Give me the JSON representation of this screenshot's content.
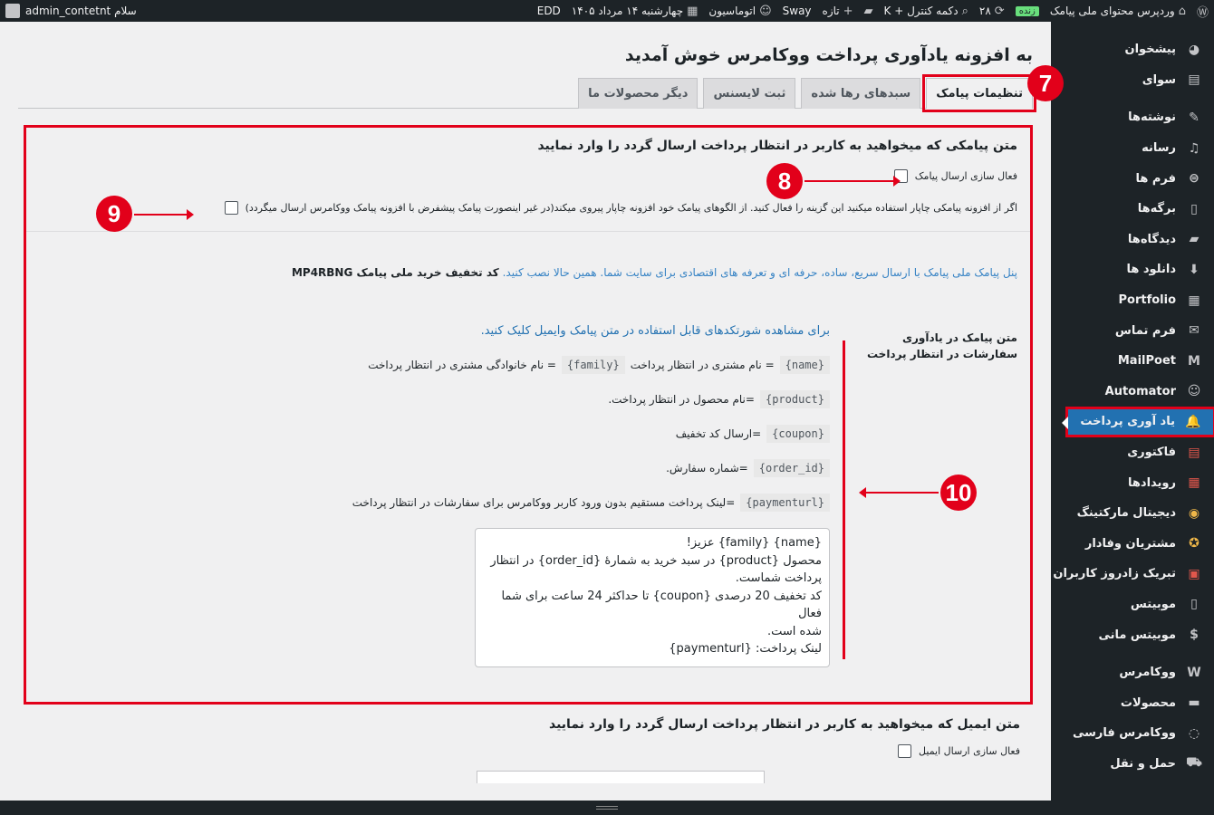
{
  "adminbar": {
    "site_name": "وردپرس محتوای ملی پیامک",
    "live_badge": "زنده",
    "updates_count": "۲۸",
    "control_button": "دکمه کنترل + K",
    "new_label": "تازه",
    "sway": "Sway",
    "automation": "اتوماسیون",
    "date": "چهارشنبه ۱۴ مرداد ۱۴۰۵",
    "edd": "EDD",
    "greeting": "سلام admin_contetnt"
  },
  "sidebar": {
    "items": [
      {
        "label": "پیشخوان",
        "icon": "dashboard-icon"
      },
      {
        "label": "سوای",
        "icon": "grid-icon"
      },
      {
        "label": "نوشته‌ها",
        "icon": "pin-icon"
      },
      {
        "label": "رسانه",
        "icon": "media-icon"
      },
      {
        "label": "فرم ها",
        "icon": "form-icon"
      },
      {
        "label": "برگه‌ها",
        "icon": "pages-icon"
      },
      {
        "label": "دیدگاه‌ها",
        "icon": "comment-icon"
      },
      {
        "label": "دانلود ها",
        "icon": "download-icon"
      },
      {
        "label": "Portfolio",
        "icon": "portfolio-icon"
      },
      {
        "label": "فرم تماس",
        "icon": "mail-icon"
      },
      {
        "label": "MailPoet",
        "icon": "mailpoet-icon"
      },
      {
        "label": "Automator",
        "icon": "automator-icon"
      },
      {
        "label": "یاد آوری پرداخت",
        "icon": "bell-icon"
      },
      {
        "label": "فاکتوری",
        "icon": "invoice-icon"
      },
      {
        "label": "رویدادها",
        "icon": "calendar-icon"
      },
      {
        "label": "دیجیتال مارکتینگ",
        "icon": "megaphone-icon"
      },
      {
        "label": "مشتریان وفادار",
        "icon": "medal-icon"
      },
      {
        "label": "تبریک زادروز کاربران",
        "icon": "cake-icon"
      },
      {
        "label": "موبیتس",
        "icon": "phone-icon"
      },
      {
        "label": "موبیتس مانی",
        "icon": "dollar-icon"
      },
      {
        "label": "ووکامرس",
        "icon": "woo-icon"
      },
      {
        "label": "محصولات",
        "icon": "archive-icon"
      },
      {
        "label": "ووکامرس فارسی",
        "icon": "woo-fa-icon"
      },
      {
        "label": "حمل و نقل",
        "icon": "truck-icon"
      }
    ]
  },
  "page": {
    "title": "به افزونه یادآوری پرداخت ووکامرس خوش آمدید",
    "tabs": [
      "تنظیمات پیامک",
      "سبدهای رها شده",
      "ثبت لایسنس",
      "دیگر محصولات ما"
    ]
  },
  "sms": {
    "heading": "متن پیامکی که میخواهید به کاربر در انتظار پرداخت ارسال گردد را وارد نمایید",
    "enable_label": "فعال سازی ارسال پیامک",
    "chapar_label": "اگر از افزونه پیامکی چاپار استفاده میکنید این گزینه را فعال کنید. از الگوهای پیامک خود افزونه چاپار پیروی میکند(در غیر اینصورت پیامک پیشفرض با افزونه پیامک ووکامرس ارسال میگردد)",
    "promo_text": "پنل پیامک ملی پیامک با ارسال سریع، ساده، حرفه ای و تعرفه های اقتصادی برای سایت شما. همین حالا نصب کنید.",
    "promo_code": "کد تخفیف خرید ملی پیامک MP4RBNG",
    "field_label": "متن پیامک در یادآوری سفارشات در انتظار پرداخت",
    "hint": "برای مشاهده شورتکدهای قابل استفاده در متن پیامک وایمیل کلیک کنید.",
    "shortcodes": [
      {
        "code": "{name}",
        "desc": "= نام مشتری در انتظار پرداخت",
        "code2": "{family}",
        "desc2": "= نام خانوادگی مشتری در انتظار پرداخت"
      },
      {
        "code": "{product}",
        "desc": "=نام محصول در انتظار پرداخت."
      },
      {
        "code": "{coupon}",
        "desc": "=ارسال کد تخفیف"
      },
      {
        "code": "{order_id}",
        "desc": "=شماره سفارش."
      },
      {
        "code": "{paymenturl}",
        "desc": "=لینک پرداخت مستقیم بدون ورود کاربر ووکامرس برای سفارشات در انتظار پرداخت"
      }
    ],
    "message_lines": [
      "{name} {family} عزیز!",
      "محصول {product} در سبد خرید به شمارهٔ {order_id} در انتظار",
      "پرداخت شماست.",
      "کد تخفیف 20 درصدی {coupon} تا حداکثر 24 ساعت برای شما فعال",
      "شده است.",
      "لینک پرداخت: {paymenturl}"
    ]
  },
  "email": {
    "heading": "متن ایمیل که میخواهید به کاربر در انتظار پرداخت ارسال گردد را وارد نمایید",
    "enable_label": "فعال سازی ارسال ایمیل"
  },
  "callouts": [
    "7",
    "8",
    "9",
    "10"
  ],
  "colors": {
    "accent_red": "#e2001a",
    "admin_dark": "#1d2327",
    "wp_blue": "#2271b1"
  }
}
